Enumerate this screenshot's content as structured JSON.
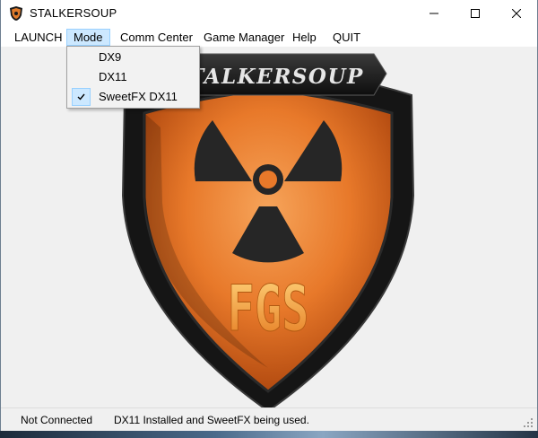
{
  "window": {
    "title": "STALKERSOUP"
  },
  "menu": {
    "items": [
      {
        "label": "LAUNCH"
      },
      {
        "label": "Mode"
      },
      {
        "label": "Comm Center"
      },
      {
        "label": "Game Manager"
      },
      {
        "label": "Help"
      },
      {
        "label": "QUIT"
      }
    ]
  },
  "mode_menu": {
    "options": [
      {
        "label": "DX9",
        "checked": false
      },
      {
        "label": "DX11",
        "checked": false
      },
      {
        "label": "SweetFX DX11",
        "checked": true
      }
    ]
  },
  "logo": {
    "banner_text": "STALKERSOUP",
    "emblem_text": "FGS",
    "icon": "radiation-shield-logo"
  },
  "statusbar": {
    "connection": "Not Connected",
    "message": "DX11 Installed and SweetFX being used."
  },
  "colors": {
    "menu_highlight": "#cce8ff",
    "menu_highlight_border": "#99d1ff",
    "shield_orange": "#e87a24",
    "shield_dark": "#1b1b1b"
  }
}
